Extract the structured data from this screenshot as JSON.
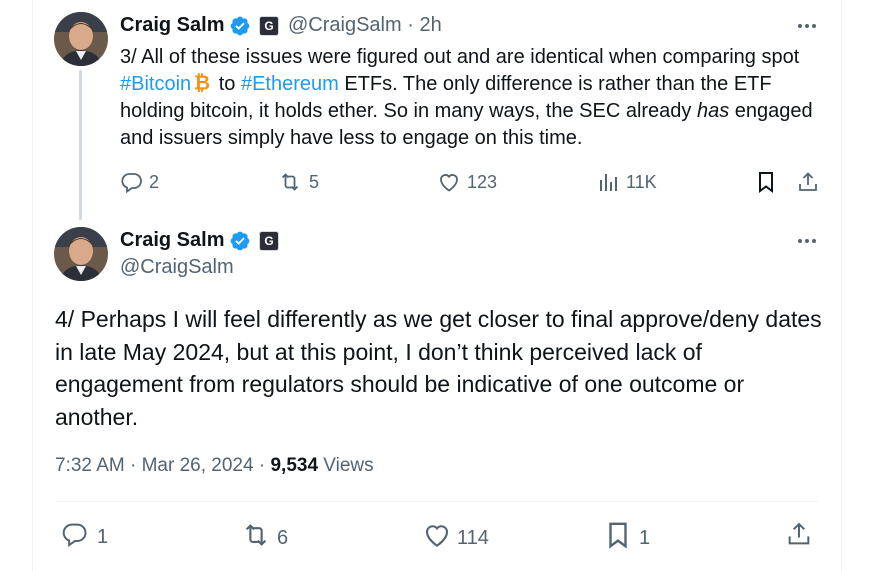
{
  "reply_tweet": {
    "author_name": "Craig Salm",
    "handle": "@CraigSalm",
    "separator": "·",
    "time_ago": "2h",
    "text_part1": "3/ All of these issues were figured out and are identical when comparing spot ",
    "hashtag_bitcoin": "#Bitcoin",
    "text_to": " to ",
    "hashtag_ethereum": "#Ethereum",
    "text_part2": " ETFs. The only difference is rather than the ETF holding bitcoin, it holds ether. So in many ways, the SEC already ",
    "text_emphasis": "has",
    "text_part3": " engaged and issuers simply have less to engage on this time.",
    "replies": "2",
    "reposts": "5",
    "likes": "123",
    "views": "11K"
  },
  "main_tweet": {
    "author_name": "Craig Salm",
    "handle": "@CraigSalm",
    "text": "4/ Perhaps I will feel differently as we get closer to final approve/deny dates in late May 2024, but at this point, I don’t think perceived lack of engagement from regulators should be indicative of one outcome or another.",
    "time": "7:32 AM",
    "date": "Mar 26, 2024",
    "separator": "·",
    "views_count": "9,534",
    "views_label": "Views",
    "replies": "1",
    "reposts": "6",
    "likes": "114",
    "bookmarks": "1"
  },
  "icons": {
    "verified": "verified-badge-icon",
    "affiliate": "G",
    "bitcoin": "bitcoin-icon"
  },
  "colors": {
    "link": "#1d9bf0",
    "muted": "#536471",
    "verified": "#1d9bf0",
    "bitcoin": "#f7931a"
  }
}
